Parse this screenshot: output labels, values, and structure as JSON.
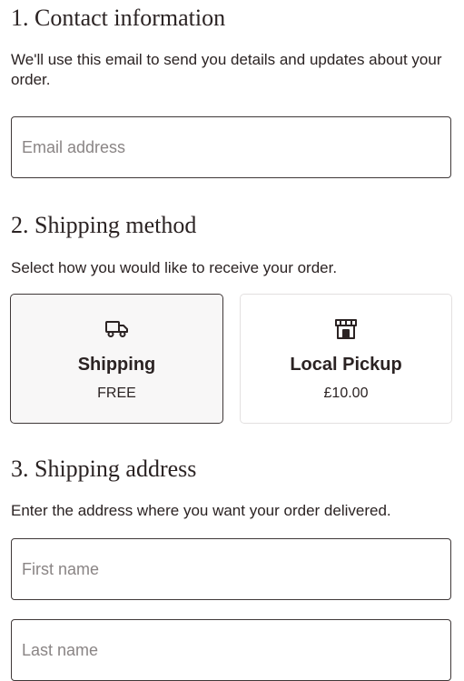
{
  "contact": {
    "title": "1. Contact information",
    "description": "We'll use this email to send you details and updates about your order.",
    "email_placeholder": "Email address"
  },
  "shipping_method": {
    "title": "2. Shipping method",
    "description": "Select how you would like to receive your order.",
    "options": [
      {
        "name": "Shipping",
        "price": "FREE",
        "icon": "truck-icon",
        "selected": true
      },
      {
        "name": "Local Pickup",
        "price": "£10.00",
        "icon": "store-icon",
        "selected": false
      }
    ]
  },
  "shipping_address": {
    "title": "3. Shipping address",
    "description": "Enter the address where you want your order delivered.",
    "first_name_placeholder": "First name",
    "last_name_placeholder": "Last name"
  },
  "colors": {
    "text": "#2b2323",
    "border": "#3f3838",
    "placeholder": "#8a8585",
    "selected_card_bg": "#f8f7f7",
    "unselected_card_border": "#e3e0e0"
  }
}
